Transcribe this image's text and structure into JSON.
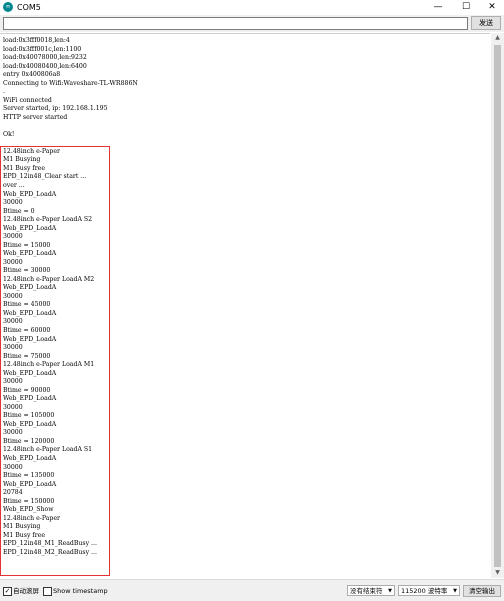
{
  "window": {
    "title": "COM5"
  },
  "controls": {
    "minimize": "—",
    "maximize": "☐",
    "close": "✕",
    "send_label": "发送"
  },
  "input": {
    "value": ""
  },
  "output_lines": [
    "load:0x3fff0018,len:4",
    "load:0x3fff001c,len:1100",
    "load:0x40078000,len:9232",
    "load:0x40080400,len:6400",
    "entry 0x400806a8",
    "Connecting to Wifi:Waveshare-TL-WR886N",
    ".",
    "WiFi connected",
    "Server started, ip: 192.168.1.195",
    "HTTP server started",
    "",
    "Ok!",
    "",
    "12.48inch e-Paper",
    "M1 Busying",
    "M1 Busy free",
    "EPD_12in48_Clear start ...",
    "over ...",
    "Web_EPD_LoadA",
    "30000",
    "Btime = 0",
    "12.48inch e-Paper LoadA S2",
    "Web_EPD_LoadA",
    "30000",
    "Btime = 15000",
    "Web_EPD_LoadA",
    "30000",
    "Btime = 30000",
    "12.48inch e-Paper LoadA M2",
    "Web_EPD_LoadA",
    "30000",
    "Btime = 45000",
    "Web_EPD_LoadA",
    "30000",
    "Btime = 60000",
    "Web_EPD_LoadA",
    "30000",
    "Btime = 75000",
    "12.48inch e-Paper LoadA M1",
    "Web_EPD_LoadA",
    "30000",
    "Btime = 90000",
    "Web_EPD_LoadA",
    "30000",
    "Btime = 105000",
    "Web_EPD_LoadA",
    "30000",
    "Btime = 120000",
    "12.48inch e-Paper LoadA S1",
    "Web_EPD_LoadA",
    "30000",
    "Btime = 135000",
    "Web_EPD_LoadA",
    "20784",
    "Btime = 150000",
    "Web_EPD_Show",
    "12.48inch e-Paper",
    "M1 Busying",
    "M1 Busy free",
    "EPD_12in48_M1_ReadBusy ...",
    "EPD_12in48_M2_ReadBusy ..."
  ],
  "bottom": {
    "autoscroll_label": "自动滚屏",
    "autoscroll_checked": true,
    "timestamp_label": "Show timestamp",
    "timestamp_checked": false,
    "line_ending": "没有结束符",
    "baud": "115200 波特率",
    "clear_label": "清空输出"
  },
  "colors": {
    "highlight": "#e53333",
    "app_icon": "#00878f"
  }
}
